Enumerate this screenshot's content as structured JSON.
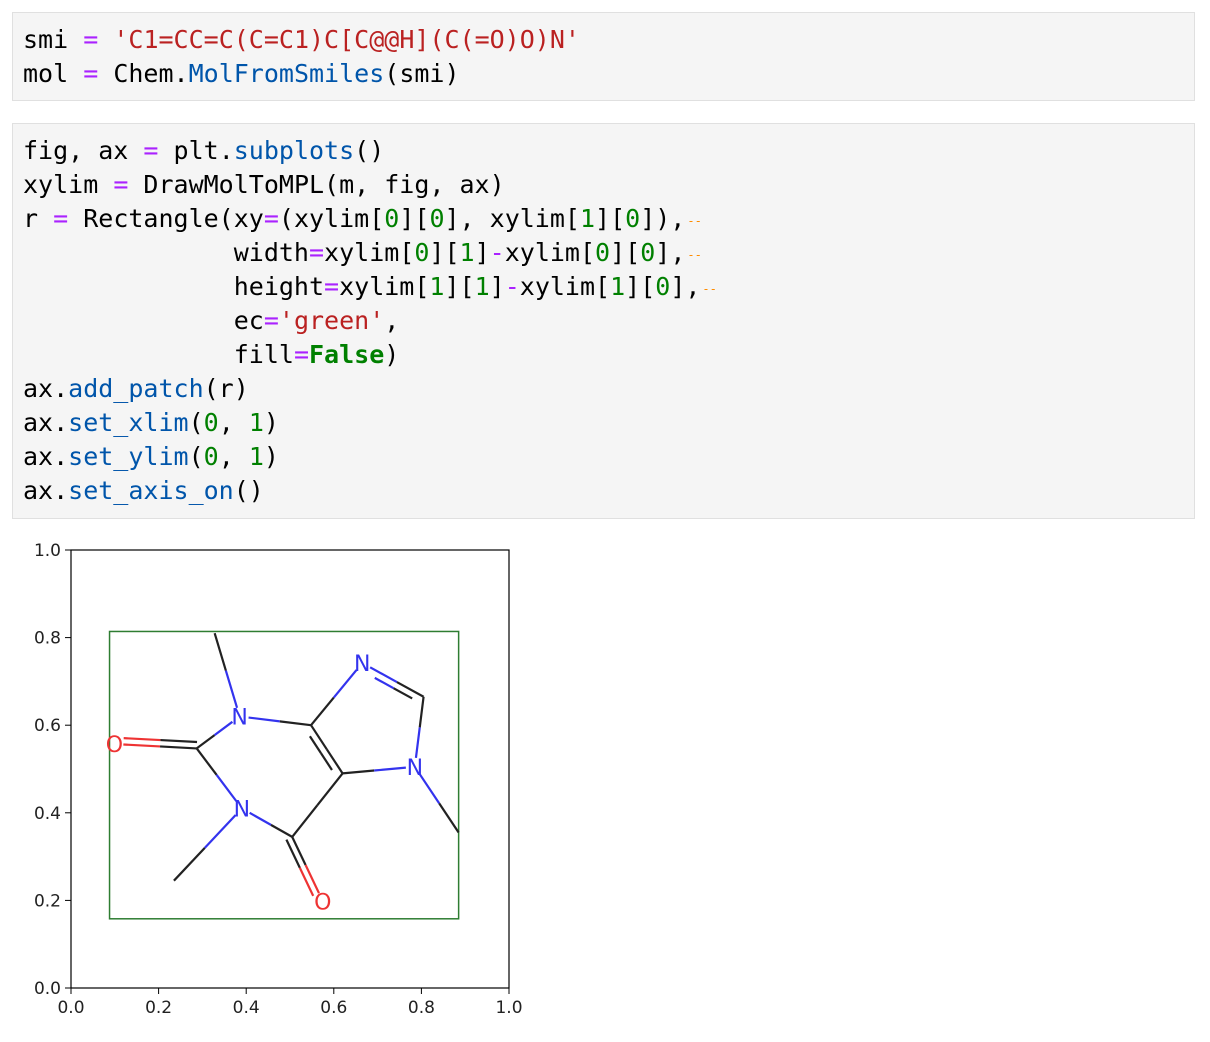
{
  "cells": [
    {
      "lines": [
        [
          {
            "t": "smi"
          },
          {
            "t": " "
          },
          {
            "t": "=",
            "c": "op"
          },
          {
            "t": " "
          },
          {
            "t": "'C1=CC=C(C=C1)C[C@@H](C(=O)O)N'",
            "c": "str"
          }
        ],
        [
          {
            "t": "mol"
          },
          {
            "t": " "
          },
          {
            "t": "=",
            "c": "op"
          },
          {
            "t": " Chem."
          },
          {
            "t": "MolFromSmiles",
            "c": "fn"
          },
          {
            "t": "(smi)"
          }
        ]
      ]
    },
    {
      "lines": [
        [
          {
            "t": "fig, ax "
          },
          {
            "t": "=",
            "c": "op"
          },
          {
            "t": " plt."
          },
          {
            "t": "subplots",
            "c": "fn"
          },
          {
            "t": "()"
          }
        ],
        [
          {
            "t": "xylim "
          },
          {
            "t": "=",
            "c": "op"
          },
          {
            "t": " DrawMolToMPL(m, fig, ax)"
          }
        ],
        [
          {
            "t": "r "
          },
          {
            "t": "=",
            "c": "op"
          },
          {
            "t": " Rectangle(xy"
          },
          {
            "t": "=",
            "c": "op"
          },
          {
            "t": "(xylim["
          },
          {
            "t": "0",
            "c": "num"
          },
          {
            "t": "]["
          },
          {
            "t": "0",
            "c": "num"
          },
          {
            "t": "], xylim["
          },
          {
            "t": "1",
            "c": "num"
          },
          {
            "t": "]["
          },
          {
            "t": "0",
            "c": "num"
          },
          {
            "t": "]),"
          },
          {
            "t": "--",
            "c": "dots"
          }
        ],
        [
          {
            "t": "              width"
          },
          {
            "t": "=",
            "c": "op"
          },
          {
            "t": "xylim["
          },
          {
            "t": "0",
            "c": "num"
          },
          {
            "t": "]["
          },
          {
            "t": "1",
            "c": "num"
          },
          {
            "t": "]"
          },
          {
            "t": "-",
            "c": "op"
          },
          {
            "t": "xylim["
          },
          {
            "t": "0",
            "c": "num"
          },
          {
            "t": "]["
          },
          {
            "t": "0",
            "c": "num"
          },
          {
            "t": "],"
          },
          {
            "t": "--",
            "c": "dots"
          }
        ],
        [
          {
            "t": "              height"
          },
          {
            "t": "=",
            "c": "op"
          },
          {
            "t": "xylim["
          },
          {
            "t": "1",
            "c": "num"
          },
          {
            "t": "]["
          },
          {
            "t": "1",
            "c": "num"
          },
          {
            "t": "]"
          },
          {
            "t": "-",
            "c": "op"
          },
          {
            "t": "xylim["
          },
          {
            "t": "1",
            "c": "num"
          },
          {
            "t": "]["
          },
          {
            "t": "0",
            "c": "num"
          },
          {
            "t": "],"
          },
          {
            "t": "--",
            "c": "dots"
          }
        ],
        [
          {
            "t": "              ec"
          },
          {
            "t": "=",
            "c": "op"
          },
          {
            "t": "'green'",
            "c": "str"
          },
          {
            "t": ","
          }
        ],
        [
          {
            "t": "              fill"
          },
          {
            "t": "=",
            "c": "op"
          },
          {
            "t": "False",
            "c": "kw"
          },
          {
            "t": ")"
          }
        ],
        [
          {
            "t": "ax."
          },
          {
            "t": "add_patch",
            "c": "fn"
          },
          {
            "t": "(r)"
          }
        ],
        [
          {
            "t": "ax."
          },
          {
            "t": "set_xlim",
            "c": "fn"
          },
          {
            "t": "("
          },
          {
            "t": "0",
            "c": "num"
          },
          {
            "t": ", "
          },
          {
            "t": "1",
            "c": "num"
          },
          {
            "t": ")"
          }
        ],
        [
          {
            "t": "ax."
          },
          {
            "t": "set_ylim",
            "c": "fn"
          },
          {
            "t": "("
          },
          {
            "t": "0",
            "c": "num"
          },
          {
            "t": ", "
          },
          {
            "t": "1",
            "c": "num"
          },
          {
            "t": ")"
          }
        ],
        [
          {
            "t": "ax."
          },
          {
            "t": "set_axis_on",
            "c": "fn"
          },
          {
            "t": "()"
          }
        ]
      ]
    }
  ],
  "token_colors": {
    "op": "#aa22ff",
    "str": "#ba2121",
    "num": "#008000",
    "fn": "#0055aa",
    "kw": "#008000",
    "dots": "#ff8c00"
  },
  "chart_data": {
    "type": "scatter",
    "xlim": [
      0.0,
      1.0
    ],
    "ylim": [
      0.0,
      1.0
    ],
    "xticks": [
      "0.0",
      "0.2",
      "0.4",
      "0.6",
      "0.8",
      "1.0"
    ],
    "yticks": [
      "0.0",
      "0.2",
      "0.4",
      "0.6",
      "0.8",
      "1.0"
    ],
    "grid": false,
    "rectangle": {
      "x0": 0.088,
      "y0": 0.158,
      "x1": 0.885,
      "y1": 0.814,
      "color": "#2e7d32"
    },
    "atoms": [
      {
        "id": "N1",
        "label": "N",
        "x": 0.39,
        "y": 0.41,
        "color": "#3333ee"
      },
      {
        "id": "C2",
        "label": "",
        "x": 0.287,
        "y": 0.547
      },
      {
        "id": "O2",
        "label": "O",
        "x": 0.099,
        "y": 0.557,
        "color": "#ee3333"
      },
      {
        "id": "N3",
        "label": "N",
        "x": 0.385,
        "y": 0.62,
        "color": "#3333ee"
      },
      {
        "id": "C4",
        "label": "",
        "x": 0.548,
        "y": 0.6
      },
      {
        "id": "C5",
        "label": "",
        "x": 0.62,
        "y": 0.49
      },
      {
        "id": "C6",
        "label": "",
        "x": 0.505,
        "y": 0.345
      },
      {
        "id": "O6",
        "label": "O",
        "x": 0.575,
        "y": 0.198,
        "color": "#ee3333"
      },
      {
        "id": "N7",
        "label": "N",
        "x": 0.785,
        "y": 0.505,
        "color": "#3333ee"
      },
      {
        "id": "C8",
        "label": "",
        "x": 0.805,
        "y": 0.665
      },
      {
        "id": "N9",
        "label": "N",
        "x": 0.665,
        "y": 0.742,
        "color": "#3333ee"
      },
      {
        "id": "Me1",
        "label": "",
        "x": 0.235,
        "y": 0.245
      },
      {
        "id": "Me3",
        "label": "",
        "x": 0.328,
        "y": 0.81
      },
      {
        "id": "Me7",
        "label": "",
        "x": 0.885,
        "y": 0.355
      }
    ],
    "bonds": [
      {
        "a": "N1",
        "b": "C2",
        "order": 1
      },
      {
        "a": "C2",
        "b": "O2",
        "order": 2
      },
      {
        "a": "C2",
        "b": "N3",
        "order": 1
      },
      {
        "a": "N3",
        "b": "C4",
        "order": 1
      },
      {
        "a": "C4",
        "b": "C5",
        "order": 2
      },
      {
        "a": "C5",
        "b": "C6",
        "order": 1
      },
      {
        "a": "C6",
        "b": "N1",
        "order": 1
      },
      {
        "a": "C6",
        "b": "O6",
        "order": 2
      },
      {
        "a": "C5",
        "b": "N7",
        "order": 1
      },
      {
        "a": "N7",
        "b": "C8",
        "order": 1
      },
      {
        "a": "C8",
        "b": "N9",
        "order": 2
      },
      {
        "a": "N9",
        "b": "C4",
        "order": 1
      },
      {
        "a": "N1",
        "b": "Me1",
        "order": 1
      },
      {
        "a": "N3",
        "b": "Me3",
        "order": 1
      },
      {
        "a": "N7",
        "b": "Me7",
        "order": 1
      }
    ]
  }
}
